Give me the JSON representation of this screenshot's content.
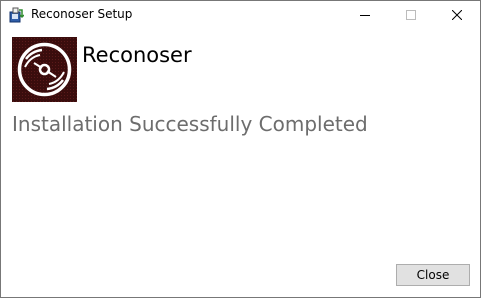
{
  "window": {
    "title": "Reconoser Setup",
    "controls": {
      "minimize_icon": "minimize-icon",
      "maximize_icon": "maximize-icon",
      "close_icon": "close-icon"
    }
  },
  "header": {
    "product_name": "Reconoser",
    "logo_icon": "disc-logo-icon"
  },
  "main": {
    "status": "Installation Successfully Completed"
  },
  "footer": {
    "close_label": "Close"
  },
  "colors": {
    "logo_background": "#3a0d0d",
    "logo_disc": "#ffffff",
    "status_text": "#6d6d6d",
    "button_face": "#e1e1e1",
    "button_border": "#adadad",
    "window_border": "#777777"
  }
}
